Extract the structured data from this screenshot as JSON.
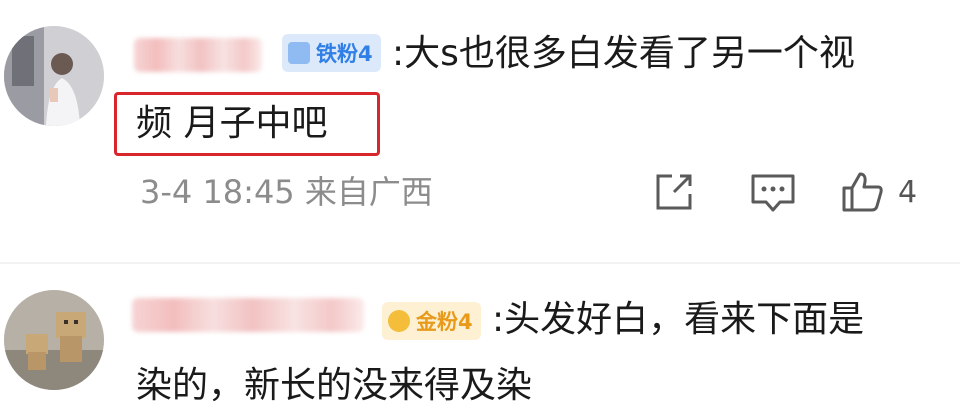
{
  "comments": [
    {
      "badge": "铁粉4",
      "text_line1": ":大s也很多白发看了另一个视",
      "text_line2": "频 月子中吧",
      "time": "3-4 18:45",
      "location": "来自广西",
      "like_count": "4",
      "actions": [
        "share-icon",
        "comment-icon",
        "like-icon"
      ]
    },
    {
      "badge": "金粉4",
      "text_line1": ":头发好白，看来下面是",
      "text_line2": "染的，新长的没来得及染"
    }
  ],
  "colors": {
    "highlight_border": "#d9262c",
    "iron_badge": "#2f7fe6",
    "gold_badge": "#e89a1a",
    "meta_text": "#8c8c8c"
  }
}
